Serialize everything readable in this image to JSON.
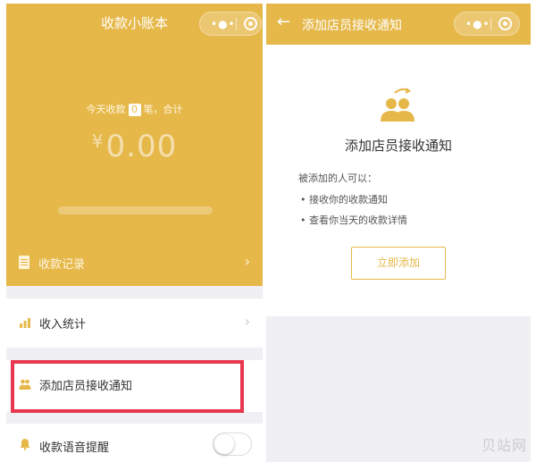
{
  "colors": {
    "accent": "#e6b84a",
    "highlight": "#e8374e",
    "background": "#efeff4"
  },
  "left": {
    "nav_title": "收款小账本",
    "capsule": {
      "dots_icon": "more-dots-icon",
      "target_icon": "close-target-icon"
    },
    "today": {
      "prefix": "今天收款",
      "count": "0",
      "suffix": "笔，合计"
    },
    "amount": {
      "currency": "¥",
      "value": "0.00"
    },
    "progress": 0.0,
    "records_label": "收款记录",
    "stats_label": "收入统计",
    "add_clerk_label": "添加店员接收通知",
    "voice_label": "收款语音提醒",
    "voice_enabled": false
  },
  "right": {
    "nav_title": "添加店员接收通知",
    "card_title": "添加店员接收通知",
    "description": "被添加的人可以：",
    "bullets": [
      "• 接收你的收款通知",
      "• 查看你当天的收款详情"
    ],
    "add_button": "立即添加"
  },
  "watermark": "贝站网"
}
